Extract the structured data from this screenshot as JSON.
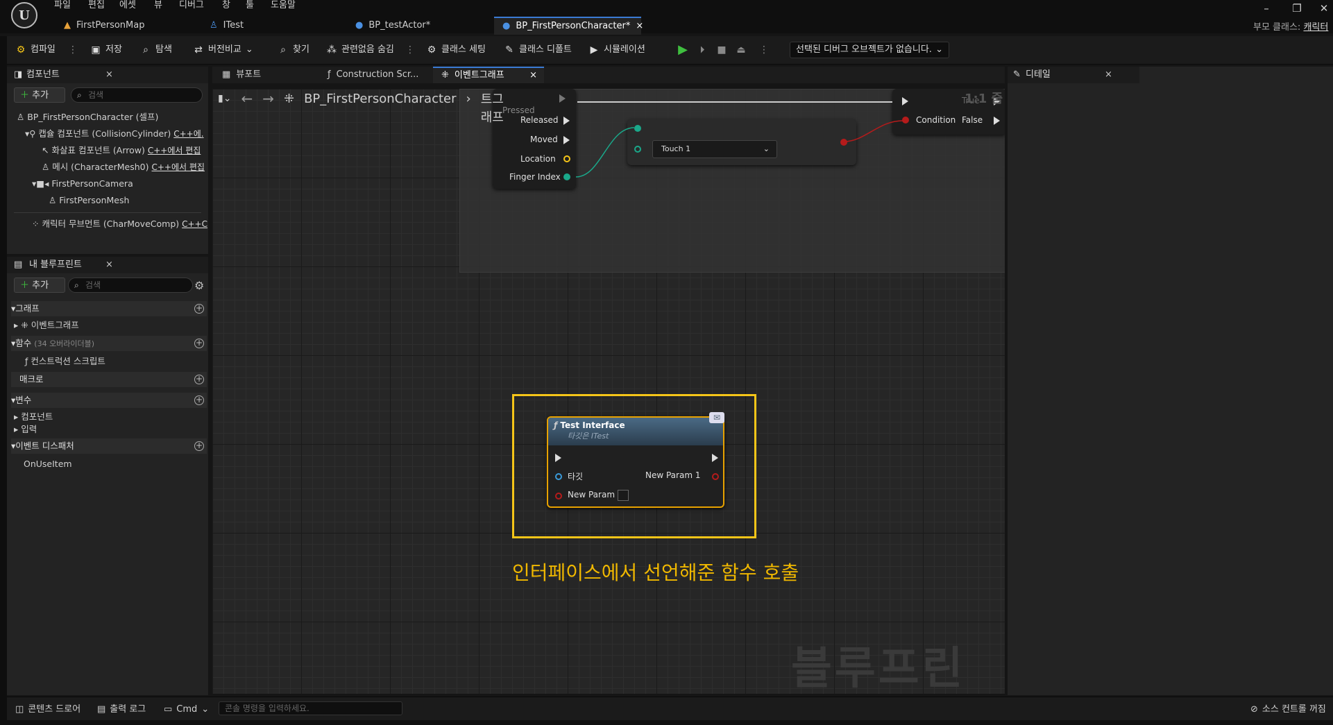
{
  "menu": [
    "파일",
    "편집",
    "에셋",
    "뷰",
    "디버그",
    "창",
    "툴",
    "도움말"
  ],
  "tabs": [
    {
      "label": "FirstPersonMap"
    },
    {
      "label": "ITest"
    },
    {
      "label": "BP_testActor*"
    },
    {
      "label": "BP_FirstPersonCharacter*",
      "close": "×"
    }
  ],
  "parent_class": {
    "label": "부모 클래스:",
    "value": "캐릭터"
  },
  "window_controls": {
    "minimize": "–",
    "restore": "❐",
    "close": "✕"
  },
  "toolbar": {
    "compile": "컴파일",
    "save": "저장",
    "browse": "탐색",
    "diff": "버전비교",
    "find": "찾기",
    "hide_unrelated": "관련없음 숨김",
    "class_settings": "클래스 세팅",
    "class_defaults": "클래스 디폴트",
    "simulate": "시뮬레이션",
    "debug_object": "선택된 디버그 오브젝트가 없습니다."
  },
  "components_panel": {
    "title": "컴포넌트",
    "add": "추가",
    "search_placeholder": "검색",
    "items": [
      {
        "label": "BP_FirstPersonCharacter (셀프)"
      },
      {
        "label": "캡슐 컴포넌트 (CollisionCylinder)",
        "edit": "C++에."
      },
      {
        "label": "화살표 컴포넌트 (Arrow)",
        "edit": "C++에서 편집"
      },
      {
        "label": "메시 (CharacterMesh0)",
        "edit": "C++에서 편집"
      },
      {
        "label": "FirstPersonCamera"
      },
      {
        "label": "FirstPersonMesh"
      },
      {
        "label": "캐릭터 무브먼트 (CharMoveComp)",
        "edit": "C++C"
      }
    ]
  },
  "my_blueprint": {
    "title": "내 블루프린트",
    "add": "추가",
    "search_placeholder": "검색",
    "graphs": "그래프",
    "event_graph": "이벤트그래프",
    "functions": "함수",
    "functions_overridable": "(34 오버라이더블)",
    "construction_script": "컨스트럭션 스크립트",
    "macros": "매크로",
    "variables": "변수",
    "var_components": "컴포넌트",
    "var_input": "입력",
    "event_dispatchers": "이벤트 디스패처",
    "dispatcher_item": "OnUseItem"
  },
  "center_tabs": [
    {
      "label": "뷰포트"
    },
    {
      "label": "Construction Scr..."
    },
    {
      "label": "이벤트그래프",
      "close": "×"
    }
  ],
  "details": {
    "title": "디테일"
  },
  "breadcrumb": {
    "blueprint": "BP_FirstPersonCharacter",
    "graph": "이벤트그래프"
  },
  "graph": {
    "touch_node": {
      "pins": [
        "Pressed",
        "Released",
        "Moved",
        "Location",
        "Finger Index"
      ]
    },
    "compare_node": {
      "value": "Touch 1"
    },
    "branch_node": {
      "condition": "Condition",
      "true_label": "True",
      "false_label": "False",
      "zoom": "1:1 줌"
    },
    "interface_node": {
      "title": "Test Interface",
      "subtitle": "타깃은 ITest",
      "target": "타깃",
      "new_param": "New Param",
      "new_param1": "New Param 1"
    },
    "annotation": "인터페이스에서 선언해준 함수 호출",
    "watermark": "블루프린트"
  },
  "bottom": {
    "content_drawer": "콘텐츠 드로어",
    "output_log": "출력 로그",
    "cmd": "Cmd",
    "console_placeholder": "콘솔 명령을 입력하세요.",
    "source_control": "소스 컨트롤 꺼짐"
  },
  "colors": {
    "accent": "#3a7bd5",
    "highlight": "#f5c518",
    "annotation": "#f0b800",
    "exec_green": "#3fbf3f"
  }
}
